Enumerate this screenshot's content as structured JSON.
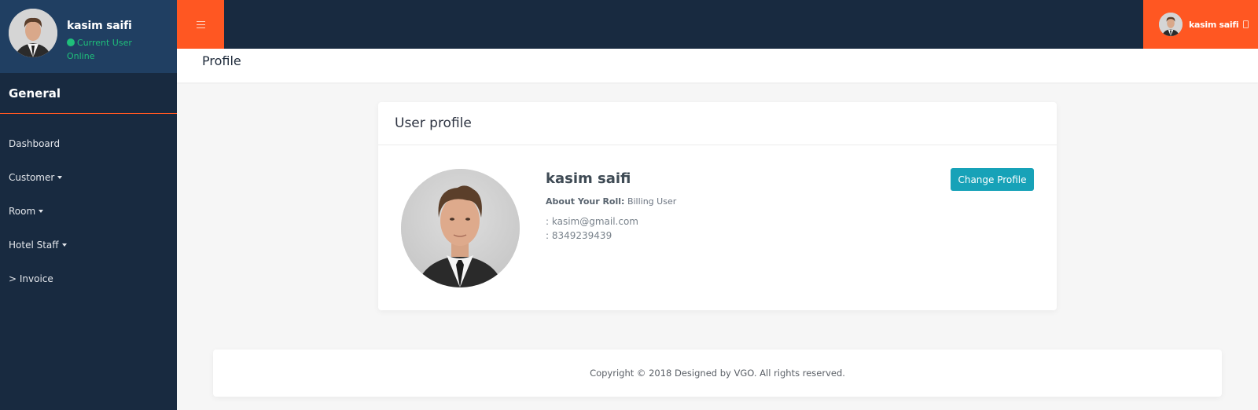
{
  "sidebar": {
    "user": {
      "name": "kasim saifi",
      "status_line1": "Current User",
      "status_line2": "Online",
      "status_color": "#1fbf7a"
    },
    "section_title": "General",
    "items": [
      {
        "label": "Dashboard",
        "has_caret": false,
        "prefix": ""
      },
      {
        "label": "Customer",
        "has_caret": true,
        "prefix": ""
      },
      {
        "label": "Room",
        "has_caret": true,
        "prefix": ""
      },
      {
        "label": "Hotel Staff",
        "has_caret": true,
        "prefix": ""
      },
      {
        "label": "Invoice",
        "has_caret": false,
        "prefix": "> "
      }
    ]
  },
  "topbar": {
    "menu_icon": "hamburger-icon",
    "user_name": "kasim saifi",
    "user_icon": "logout-icon",
    "accent_color": "#ff5722"
  },
  "page": {
    "title": "Profile"
  },
  "profile_card": {
    "title": "User profile",
    "name": "kasim saifi",
    "role_label": "About Your Roll:",
    "role_value": "Billing User",
    "email": ": kasim@gmail.com",
    "phone": ": 8349239439",
    "change_button": "Change Profile",
    "button_color": "#17a2b8"
  },
  "footer": {
    "text": "Copyright © 2018 Designed by VGO. All rights reserved."
  }
}
